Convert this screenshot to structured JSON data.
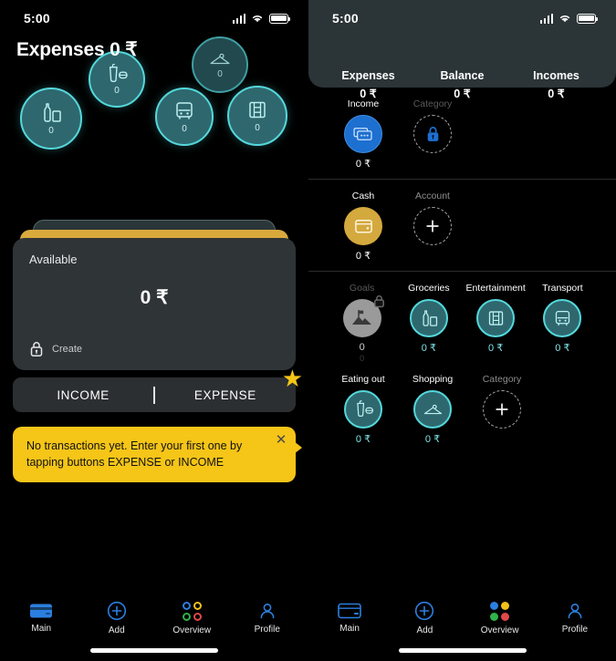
{
  "meta": {
    "status_time": "5:00"
  },
  "left": {
    "header_title": "Expenses 0 ₹",
    "bubbles": [
      {
        "name": "groceries",
        "icon": "bottle-box-icon",
        "value": "0"
      },
      {
        "name": "eating-out",
        "icon": "cup-burger-icon",
        "value": "0"
      },
      {
        "name": "shopping",
        "icon": "hanger-icon",
        "value": "0"
      },
      {
        "name": "transport",
        "icon": "bus-icon",
        "value": "0"
      },
      {
        "name": "entertainment",
        "icon": "film-icon",
        "value": "0"
      }
    ],
    "card": {
      "label": "Available",
      "amount": "0 ₹",
      "create_label": "Create",
      "create_icon": "lock-icon"
    },
    "segments": {
      "income": "INCOME",
      "expense": "EXPENSE",
      "badge_icon": "star-icon"
    },
    "tooltip": {
      "text": "No transactions yet. Enter your first one by tapping buttons EXPENSE or INCOME",
      "close_icon": "close-icon"
    }
  },
  "right": {
    "summary": [
      {
        "key": "Expenses",
        "value": "0 ₹"
      },
      {
        "key": "Balance",
        "value": "0 ₹"
      },
      {
        "key": "Incomes",
        "value": "0 ₹"
      }
    ],
    "sections": [
      {
        "name": "income-section",
        "items": [
          {
            "label": "Income",
            "value": "0 ₹",
            "icon": "banknotes-icon",
            "style": "blue"
          },
          {
            "label": "Category",
            "value": "",
            "icon": "lock-icon",
            "style": "dashed-locked"
          }
        ]
      },
      {
        "name": "accounts-section",
        "items": [
          {
            "label": "Cash",
            "value": "0 ₹",
            "icon": "wallet-icon",
            "style": "gold"
          },
          {
            "label": "Account",
            "value": "",
            "icon": "plus-icon",
            "style": "dashed-add"
          }
        ]
      },
      {
        "name": "categories-section",
        "items": [
          {
            "label": "Goals",
            "value": "0",
            "sub": "0",
            "icon": "mountain-flag-icon",
            "style": "gray-locked"
          },
          {
            "label": "Groceries",
            "value": "0 ₹",
            "icon": "bottle-box-icon",
            "style": "teal"
          },
          {
            "label": "Entertainment",
            "value": "0 ₹",
            "icon": "film-icon",
            "style": "teal"
          },
          {
            "label": "Transport",
            "value": "0 ₹",
            "icon": "bus-icon",
            "style": "teal"
          },
          {
            "label": "Eating out",
            "value": "0 ₹",
            "icon": "cup-burger-icon",
            "style": "teal"
          },
          {
            "label": "Shopping",
            "value": "0 ₹",
            "icon": "hanger-icon",
            "style": "teal"
          },
          {
            "label": "Category",
            "value": "",
            "icon": "plus-icon",
            "style": "dashed-add"
          }
        ]
      }
    ]
  },
  "nav": {
    "items": [
      {
        "label": "Main",
        "icon": "card-icon"
      },
      {
        "label": "Add",
        "icon": "plus-circle-icon"
      },
      {
        "label": "Overview",
        "icon": "four-dots-icon"
      },
      {
        "label": "Profile",
        "icon": "person-icon"
      }
    ],
    "left_active": "Main",
    "right_active": "Overview"
  },
  "colors": {
    "accent_blue": "#1d6fd0",
    "accent_teal": "#54d8dc",
    "accent_gold": "#d4a93e",
    "tooltip_yellow": "#f5c518",
    "dot_blue": "#2b7fe0",
    "dot_yellow": "#f0c11b",
    "dot_green": "#30b24a",
    "dot_red": "#e0484a"
  }
}
